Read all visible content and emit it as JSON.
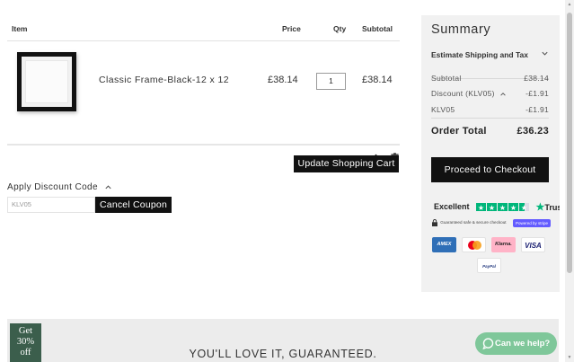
{
  "cart": {
    "headers": {
      "item": "Item",
      "price": "Price",
      "qty": "Qty",
      "subtotal": "Subtotal"
    },
    "items": [
      {
        "name": "Classic Frame-Black-12 x 12",
        "price": "£38.14",
        "qty": "1",
        "subtotal": "£38.14"
      }
    ],
    "update_label": "Update Shopping Cart"
  },
  "discount": {
    "label": "Apply Discount Code",
    "code_value": "KLV05",
    "cancel_label": "Cancel Coupon"
  },
  "summary": {
    "title": "Summary",
    "estimate_label": "Estimate Shipping and Tax",
    "subtotal_label": "Subtotal",
    "subtotal_value": "£38.14",
    "discount_label": "Discount (KLV05)",
    "discount_value": "-£1.91",
    "code_label": "KLV05",
    "code_value": "-£1.91",
    "total_label": "Order Total",
    "total_value": "£36.23",
    "checkout_label": "Proceed to Checkout"
  },
  "trust": {
    "rating_word": "Excellent",
    "brand": "Trustpilot",
    "secure_text": "Guaranteed safe & secure checkout",
    "stripe_text": "Powered by stripe",
    "cards": [
      "AMEX",
      "Klarna.",
      "VISA",
      "PayPal"
    ]
  },
  "footer": {
    "guarantee": "YOU'LL LOVE IT, GUARANTEED.",
    "promo_line1": "Get",
    "promo_line2": "30%",
    "promo_line3": "off",
    "help_label": "Can we help?"
  },
  "colors": {
    "accent_dark": "#111111",
    "trustpilot_green": "#00b67a",
    "help_green": "#7fc79a",
    "promo_green": "#3b5e4c"
  }
}
